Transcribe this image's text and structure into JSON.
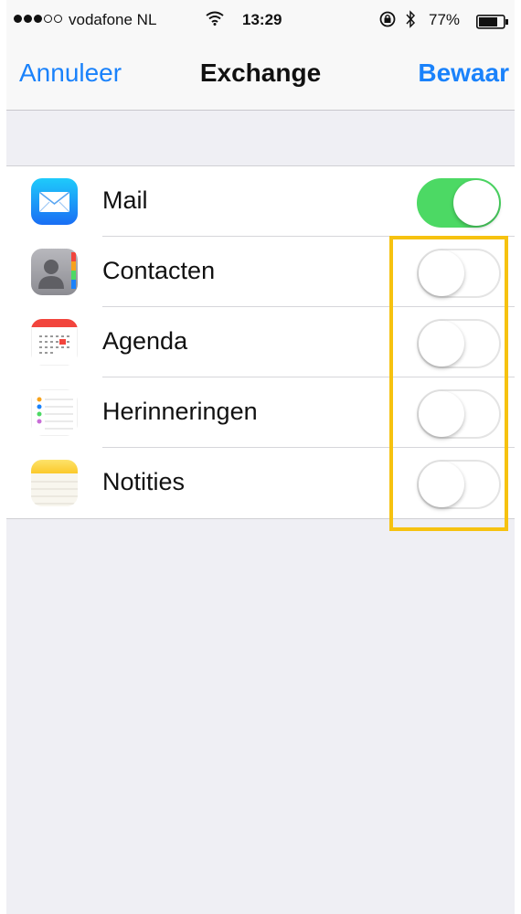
{
  "status_bar": {
    "carrier": "vodafone NL",
    "time": "13:29",
    "battery": "77%",
    "signal_bars_filled": 3,
    "signal_bars_total": 5,
    "battery_level": 0.77
  },
  "nav": {
    "cancel_label": "Annuleer",
    "title": "Exchange",
    "save_label": "Bewaar"
  },
  "colors": {
    "accent": "#1a82fb",
    "switch_on": "#4cd964",
    "highlight": "#f6c210"
  },
  "rows": [
    {
      "label": "Mail",
      "icon": "mail-icon",
      "enabled": true
    },
    {
      "label": "Contacten",
      "icon": "contacts-icon",
      "enabled": false
    },
    {
      "label": "Agenda",
      "icon": "calendar-icon",
      "enabled": false
    },
    {
      "label": "Herinneringen",
      "icon": "reminders-icon",
      "enabled": false
    },
    {
      "label": "Notities",
      "icon": "notes-icon",
      "enabled": false
    }
  ]
}
